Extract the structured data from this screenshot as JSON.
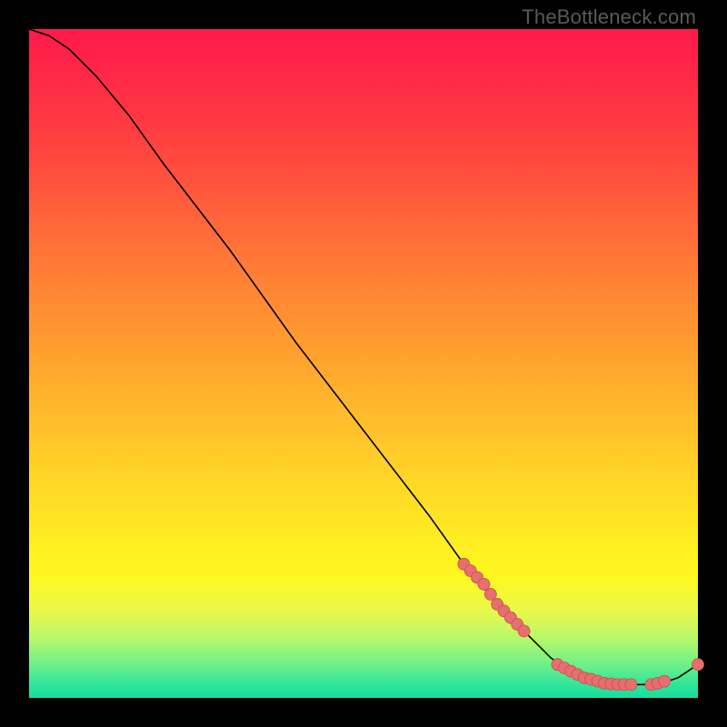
{
  "watermark": "TheBottleneck.com",
  "chart_data": {
    "type": "line",
    "title": "",
    "xlabel": "",
    "ylabel": "",
    "xlim": [
      0,
      100
    ],
    "ylim": [
      0,
      100
    ],
    "grid": false,
    "series": [
      {
        "name": "curve",
        "x": [
          0,
          3,
          6,
          10,
          15,
          20,
          30,
          40,
          50,
          60,
          65,
          70,
          74,
          78,
          82,
          86,
          90,
          94,
          97,
          100
        ],
        "y": [
          100,
          99,
          97,
          93,
          87,
          80,
          67,
          53,
          40,
          27,
          20,
          14,
          10,
          6,
          3,
          2,
          2,
          2,
          3,
          5
        ]
      }
    ],
    "markers": [
      {
        "x": 65,
        "y": 20
      },
      {
        "x": 66,
        "y": 19
      },
      {
        "x": 67,
        "y": 18
      },
      {
        "x": 68,
        "y": 17
      },
      {
        "x": 69,
        "y": 15.5
      },
      {
        "x": 70,
        "y": 14
      },
      {
        "x": 71,
        "y": 13
      },
      {
        "x": 72,
        "y": 12
      },
      {
        "x": 73,
        "y": 11
      },
      {
        "x": 74,
        "y": 10
      },
      {
        "x": 79,
        "y": 5
      },
      {
        "x": 80,
        "y": 4.5
      },
      {
        "x": 81,
        "y": 4
      },
      {
        "x": 82,
        "y": 3.5
      },
      {
        "x": 83,
        "y": 3
      },
      {
        "x": 84,
        "y": 2.8
      },
      {
        "x": 85,
        "y": 2.5
      },
      {
        "x": 86,
        "y": 2.2
      },
      {
        "x": 87,
        "y": 2.1
      },
      {
        "x": 88,
        "y": 2
      },
      {
        "x": 89,
        "y": 2
      },
      {
        "x": 90,
        "y": 2
      },
      {
        "x": 93,
        "y": 2
      },
      {
        "x": 94,
        "y": 2.2
      },
      {
        "x": 95,
        "y": 2.5
      },
      {
        "x": 100,
        "y": 5
      }
    ],
    "colors": {
      "line": "#000000",
      "marker_fill": "#e76f6f",
      "marker_stroke": "#c94f4f"
    }
  }
}
